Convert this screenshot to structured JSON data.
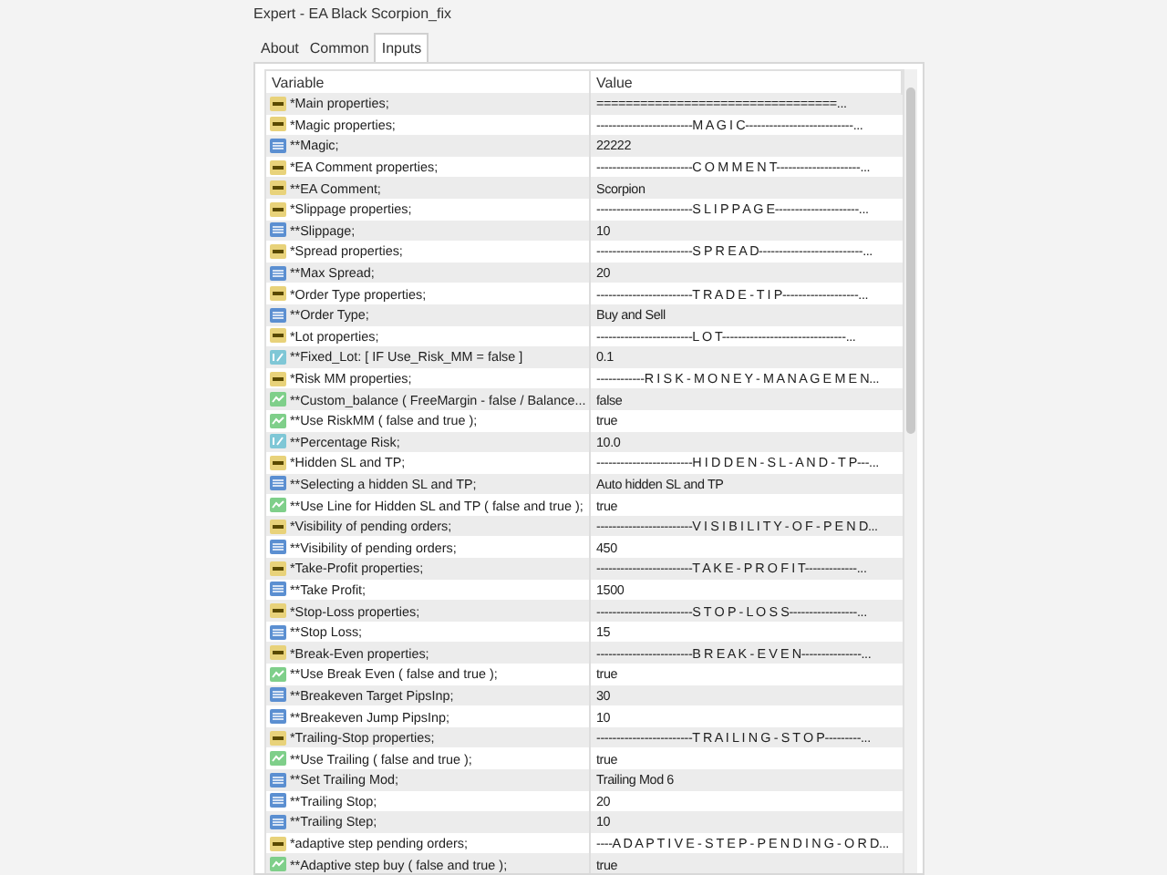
{
  "window": {
    "title": "Expert - EA Black Scorpion_fix"
  },
  "tabs": [
    {
      "label": "About",
      "selected": false
    },
    {
      "label": "Common",
      "selected": false
    },
    {
      "label": "Inputs",
      "selected": true
    }
  ],
  "table": {
    "columns": [
      "Variable",
      "Value"
    ],
    "rows": [
      {
        "kind": "string",
        "variable": "*Main properties;",
        "value": "=================================..."
      },
      {
        "kind": "string",
        "variable": "*Magic properties;",
        "value": "------------------------M A G I C---------------------------..."
      },
      {
        "kind": "int",
        "variable": "**Magic;",
        "value": "22222"
      },
      {
        "kind": "string",
        "variable": "*EA Comment properties;",
        "value": "------------------------C O M M E N T---------------------..."
      },
      {
        "kind": "string",
        "variable": "**EA Comment;",
        "value": "Scorpion"
      },
      {
        "kind": "string",
        "variable": "*Slippage properties;",
        "value": "------------------------S L I P P A G E---------------------..."
      },
      {
        "kind": "int",
        "variable": "**Slippage;",
        "value": "10"
      },
      {
        "kind": "string",
        "variable": "*Spread properties;",
        "value": "------------------------S P R E A D--------------------------..."
      },
      {
        "kind": "int",
        "variable": "**Max Spread;",
        "value": "20"
      },
      {
        "kind": "string",
        "variable": "*Order Type properties;",
        "value": "------------------------T R A D E - T I P-------------------..."
      },
      {
        "kind": "int",
        "variable": "**Order Type;",
        "value": "Buy and Sell"
      },
      {
        "kind": "string",
        "variable": "*Lot properties;",
        "value": "------------------------L O T-------------------------------..."
      },
      {
        "kind": "double",
        "variable": "**Fixed_Lot: [ IF  Use_Risk_MM = false ]",
        "value": "0.1"
      },
      {
        "kind": "string",
        "variable": "*Risk MM properties;",
        "value": "------------R I S K - M O N E Y - M A N A G E M E N..."
      },
      {
        "kind": "bool",
        "variable": "**Custom_balance ( FreeMargin - false / Balance...",
        "value": "false"
      },
      {
        "kind": "bool",
        "variable": "**Use RiskMM ( false and true );",
        "value": "true"
      },
      {
        "kind": "double",
        "variable": "**Percentage Risk;",
        "value": "10.0"
      },
      {
        "kind": "string",
        "variable": "*Hidden SL and TP;",
        "value": "------------------------H I D D E N - S L - A N D - T P---..."
      },
      {
        "kind": "int",
        "variable": "**Selecting a hidden SL and TP;",
        "value": "Auto hidden SL and TP"
      },
      {
        "kind": "bool",
        "variable": "**Use Line for Hidden SL and TP ( false and true );",
        "value": "true"
      },
      {
        "kind": "string",
        "variable": "*Visibility of pending orders;",
        "value": "------------------------V I S I B I L I T Y - O F - P E N D..."
      },
      {
        "kind": "int",
        "variable": "**Visibility of pending orders;",
        "value": "450"
      },
      {
        "kind": "string",
        "variable": "*Take-Profit properties;",
        "value": "------------------------T A K E - P R O F I T-------------..."
      },
      {
        "kind": "int",
        "variable": "**Take Profit;",
        "value": "1500"
      },
      {
        "kind": "string",
        "variable": "*Stop-Loss properties;",
        "value": "------------------------S T O P - L O S S-----------------..."
      },
      {
        "kind": "int",
        "variable": "**Stop Loss;",
        "value": "15"
      },
      {
        "kind": "string",
        "variable": "*Break-Even properties;",
        "value": "------------------------B R E A K - E V E N---------------..."
      },
      {
        "kind": "bool",
        "variable": "**Use Break Even ( false and true );",
        "value": "true"
      },
      {
        "kind": "int",
        "variable": "**Breakeven Target PipsInp;",
        "value": "30"
      },
      {
        "kind": "int",
        "variable": "**Breakeven Jump PipsInp;",
        "value": "10"
      },
      {
        "kind": "string",
        "variable": "*Trailing-Stop properties;",
        "value": "------------------------T R A I L I N G - S T O P---------..."
      },
      {
        "kind": "bool",
        "variable": "**Use Trailing ( false and true );",
        "value": "true"
      },
      {
        "kind": "int",
        "variable": "**Set Trailing Mod;",
        "value": "Trailing Mod 6"
      },
      {
        "kind": "int",
        "variable": "**Trailing Stop;",
        "value": "20"
      },
      {
        "kind": "int",
        "variable": "**Trailing Step;",
        "value": "10"
      },
      {
        "kind": "string",
        "variable": "*adaptive step pending orders;",
        "value": "----A D A P T I V E - S T E P - P E N D I N G - O R D..."
      },
      {
        "kind": "bool",
        "variable": "**Adaptive step buy ( false and true );",
        "value": "true"
      }
    ]
  }
}
